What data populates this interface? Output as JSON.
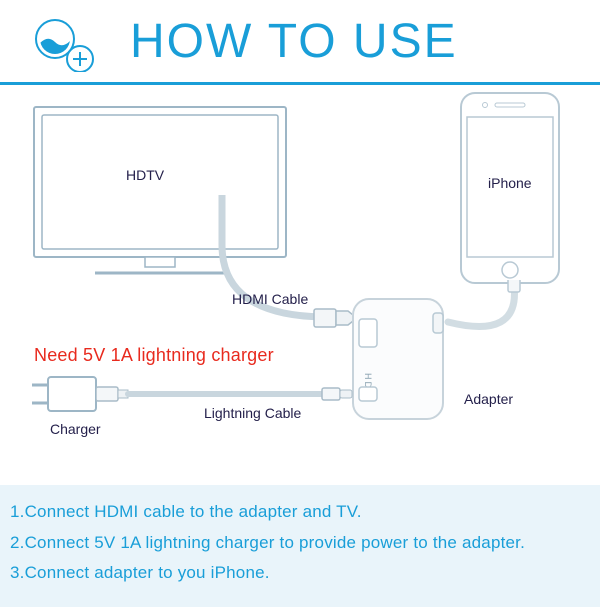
{
  "title": "HOW TO USE",
  "labels": {
    "hdtv": "HDTV",
    "iphone": "iPhone",
    "hdmi_cable": "HDMI Cable",
    "lightning_cable": "Lightning Cable",
    "charger": "Charger",
    "adapter": "Adapter",
    "hdmi_port": "HDMI"
  },
  "warning": "Need 5V 1A lightning charger",
  "instructions": [
    "1.Connect HDMI cable to the adapter and TV.",
    "2.Connect 5V 1A lightning charger to provide power to the adapter.",
    "3.Connect adapter to you iPhone."
  ],
  "colors": {
    "accent": "#199ed8",
    "warning": "#e82a1e",
    "stroke": "#9db6c6"
  }
}
